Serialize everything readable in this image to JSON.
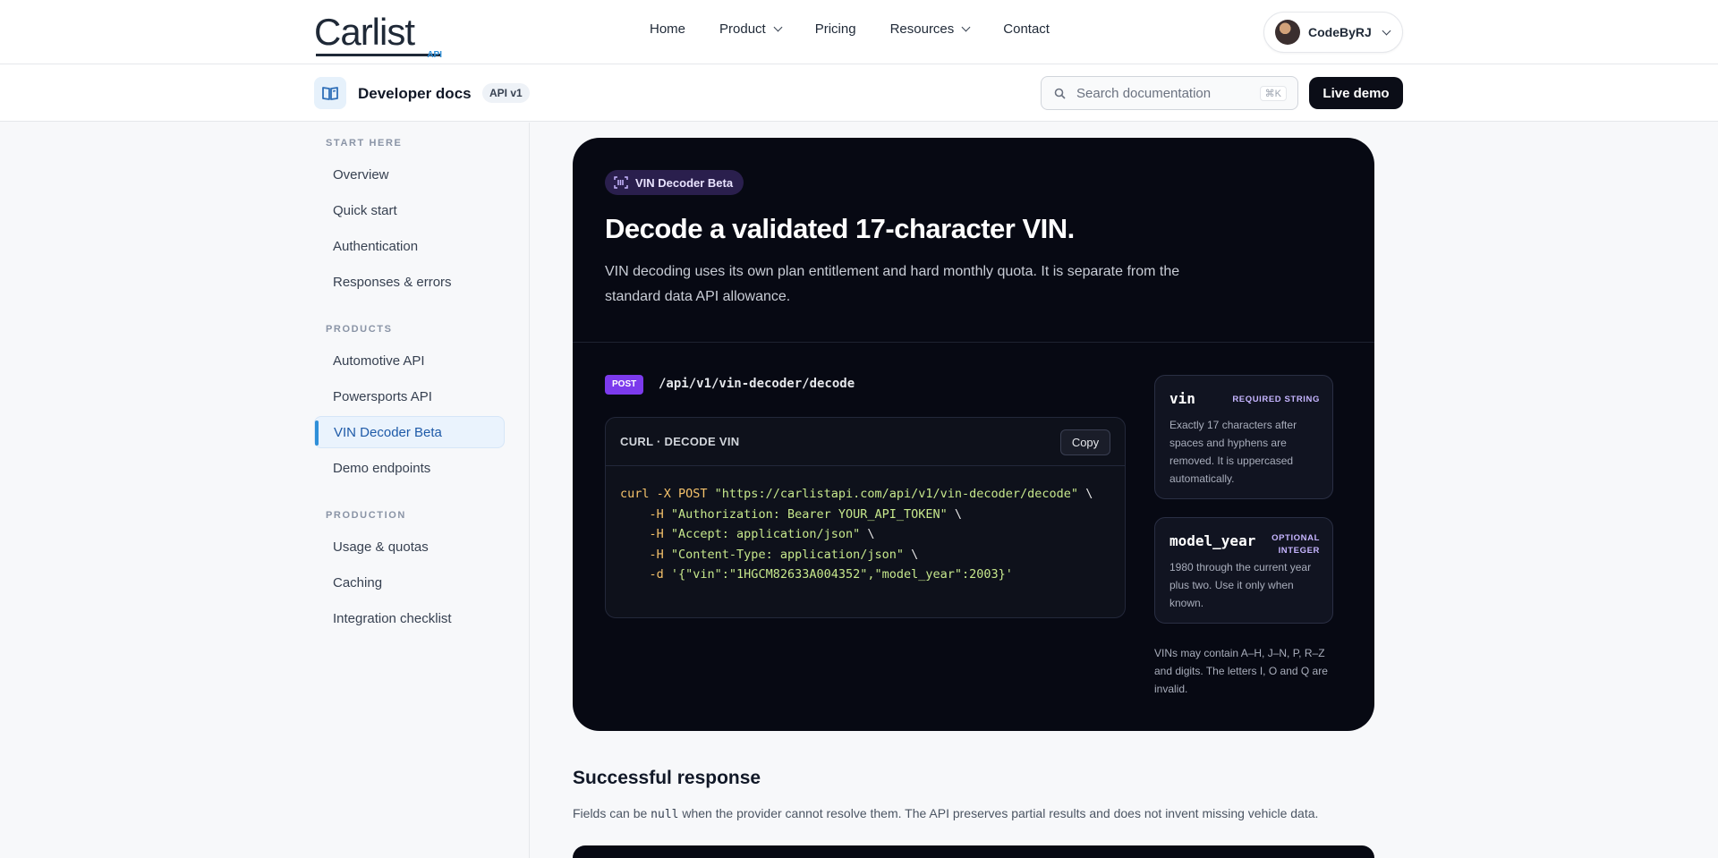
{
  "brand": {
    "name": "Carlist",
    "sub": "API"
  },
  "topnav": {
    "items": [
      {
        "label": "Home",
        "has_menu": false
      },
      {
        "label": "Product",
        "has_menu": true
      },
      {
        "label": "Pricing",
        "has_menu": false
      },
      {
        "label": "Resources",
        "has_menu": true
      },
      {
        "label": "Contact",
        "has_menu": false
      }
    ],
    "user": {
      "name": "CodeByRJ"
    }
  },
  "docs_header": {
    "title": "Developer docs",
    "version_badge": "API v1",
    "search_placeholder": "Search documentation",
    "search_shortcut": "⌘K",
    "live_demo_label": "Live demo"
  },
  "sidebar": {
    "sections": [
      {
        "label": "START HERE",
        "items": [
          "Overview",
          "Quick start",
          "Authentication",
          "Responses & errors"
        ]
      },
      {
        "label": "PRODUCTS",
        "items": [
          "Automotive API",
          "Powersports API",
          "VIN Decoder Beta",
          "Demo endpoints"
        ]
      },
      {
        "label": "PRODUCTION",
        "items": [
          "Usage & quotas",
          "Caching",
          "Integration checklist"
        ]
      }
    ],
    "active_item": "VIN Decoder Beta"
  },
  "hero": {
    "badge": "VIN Decoder Beta",
    "title": "Decode a validated 17-character VIN.",
    "lead": "VIN decoding uses its own plan entitlement and hard monthly quota. It is separate from the standard data API allowance.",
    "method": "POST",
    "endpoint": "/api/v1/vin-decoder/decode",
    "code_title": "CURL · DECODE VIN",
    "copy_label": "Copy",
    "code_lines": [
      {
        "cmd": "curl -X POST ",
        "str": "\"https://carlistapi.com/api/v1/vin-decoder/decode\"",
        "tail": " \\"
      },
      {
        "cmd": "    -H ",
        "str": "\"Authorization: Bearer YOUR_API_TOKEN\"",
        "tail": " \\"
      },
      {
        "cmd": "    -H ",
        "str": "\"Accept: application/json\"",
        "tail": " \\"
      },
      {
        "cmd": "    -H ",
        "str": "\"Content-Type: application/json\"",
        "tail": " \\"
      },
      {
        "cmd": "    -d ",
        "str": "'{\"vin\":\"1HGCM82633A004352\",\"model_year\":2003}'",
        "tail": ""
      }
    ],
    "params": [
      {
        "name": "vin",
        "type": "REQUIRED STRING",
        "desc": "Exactly 17 characters after spaces and hyphens are removed. It is uppercased automatically."
      },
      {
        "name": "model_year",
        "type": "OPTIONAL INTEGER",
        "desc": "1980 through the current year plus two. Use it only when known."
      }
    ],
    "note": "VINs may contain A–H, J–N, P, R–Z and digits. The letters I, O and Q are invalid."
  },
  "response": {
    "title": "Successful response",
    "text_before": "Fields can be ",
    "text_code": "null",
    "text_after": " when the provider cannot resolve them. The API preserves partial results and does not invent missing vehicle data."
  }
}
